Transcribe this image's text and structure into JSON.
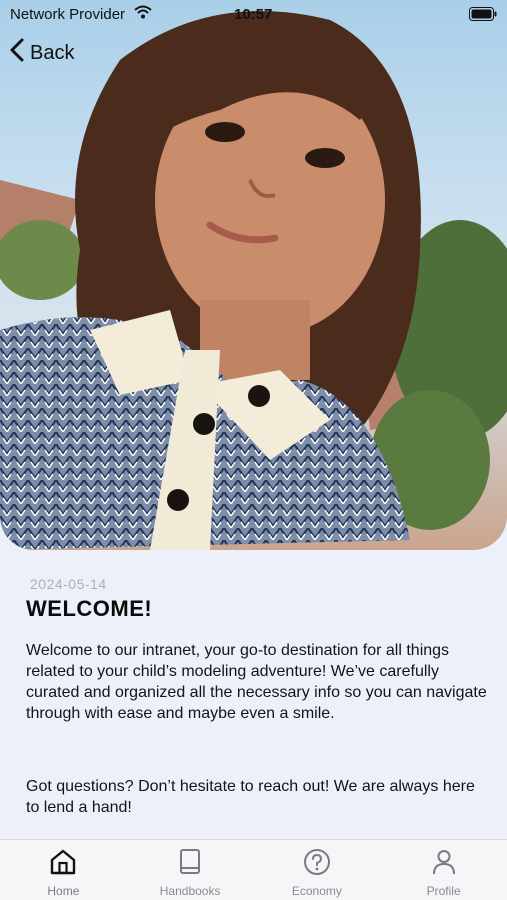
{
  "status_bar": {
    "carrier": "Network Provider",
    "time": "10:57"
  },
  "nav": {
    "back_label": "Back"
  },
  "article": {
    "date": "2024-05-14",
    "title": "WELCOME!",
    "paragraph1": "Welcome to our intranet, your go-to destination for all things related to your child’s modeling adventure! We’ve carefully curated and organized all the necessary info so you can navigate through with ease and maybe even a smile.",
    "paragraph2": "Got questions? Don’t hesitate to reach out! We are always here to lend a hand!"
  },
  "tabs": [
    {
      "label": "Home",
      "icon": "home-icon"
    },
    {
      "label": "Handbooks",
      "icon": "book-icon"
    },
    {
      "label": "Economy",
      "icon": "question-icon"
    },
    {
      "label": "Profile",
      "icon": "person-icon"
    }
  ]
}
